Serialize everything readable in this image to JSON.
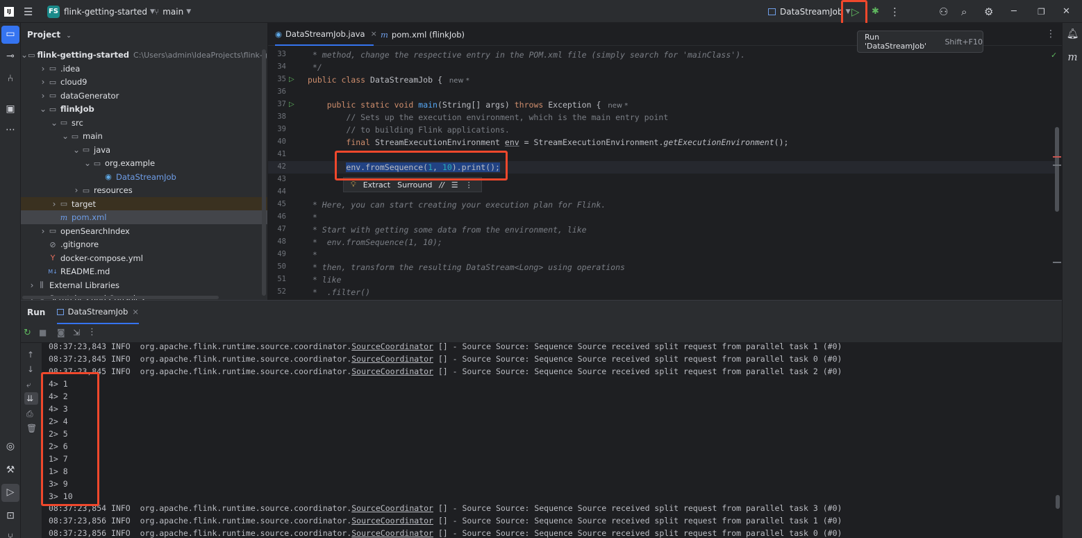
{
  "titlebar": {
    "app_icon": "intellij-icon",
    "menu_icon": "hamburger-icon",
    "project_badge": "FS",
    "project_name": "flink-getting-started",
    "branch_icon": "git-branch-icon",
    "branch": "main",
    "run_config": "DataStreamJob",
    "run_icon": "play-icon",
    "debug_icon": "bug-icon",
    "more_icon": "vertical-dots-icon",
    "add_user_icon": "add-user-icon",
    "search_icon": "search-icon",
    "settings_icon": "gear-icon"
  },
  "tooltip": {
    "label": "Run 'DataStreamJob'",
    "shortcut": "Shift+F10"
  },
  "project": {
    "title": "Project",
    "tree": [
      {
        "label": "flink-getting-started",
        "hint": "C:\\Users\\admin\\IdeaProjects\\flink-getting-started",
        "icon": "folder-icon",
        "depth": 0,
        "expanded": true
      },
      {
        "label": ".idea",
        "icon": "folder-icon",
        "depth": 1,
        "expanded": false
      },
      {
        "label": "cloud9",
        "icon": "folder-icon",
        "depth": 1,
        "expanded": false
      },
      {
        "label": "dataGenerator",
        "icon": "folder-icon",
        "depth": 1,
        "expanded": false
      },
      {
        "label": "flinkJob",
        "icon": "folder-icon",
        "depth": 1,
        "expanded": true
      },
      {
        "label": "src",
        "icon": "folder-icon",
        "depth": 2,
        "expanded": true
      },
      {
        "label": "main",
        "icon": "folder-icon",
        "depth": 3,
        "expanded": true
      },
      {
        "label": "java",
        "icon": "folder-icon",
        "depth": 4,
        "expanded": true
      },
      {
        "label": "org.example",
        "icon": "package-icon",
        "depth": 5,
        "expanded": true
      },
      {
        "label": "DataStreamJob",
        "icon": "class-icon",
        "depth": 6,
        "leaf": true
      },
      {
        "label": "resources",
        "icon": "folder-icon",
        "depth": 4,
        "expanded": false
      },
      {
        "label": "target",
        "icon": "folder-icon",
        "depth": 2,
        "expanded": false
      },
      {
        "label": "pom.xml",
        "icon": "maven-icon",
        "depth": 2,
        "leaf": true
      },
      {
        "label": "openSearchIndex",
        "icon": "folder-icon",
        "depth": 1,
        "expanded": false
      },
      {
        "label": ".gitignore",
        "icon": "ignore-icon",
        "depth": 1,
        "leaf": true
      },
      {
        "label": "docker-compose.yml",
        "icon": "yaml-icon",
        "depth": 1,
        "leaf": true
      },
      {
        "label": "README.md",
        "icon": "markdown-icon",
        "depth": 1,
        "leaf": true
      },
      {
        "label": "External Libraries",
        "icon": "library-icon",
        "depth": 0,
        "expanded": false
      },
      {
        "label": "Scratches and Consoles",
        "icon": "scratch-icon",
        "depth": 0,
        "expanded": false
      }
    ]
  },
  "editor": {
    "tabs": [
      {
        "label": "DataStreamJob.java",
        "active": true
      },
      {
        "label": "pom.xml (flinkJob)",
        "active": false
      }
    ],
    "inline_hint": "new *",
    "popup": {
      "extract": "Extract",
      "surround": "Surround",
      "comment": "//"
    },
    "lines": [
      {
        "num": "33",
        "text": " * method, change the respective entry in the POM.xml file (simply search for 'mainClass')."
      },
      {
        "num": "34",
        "text": " */"
      },
      {
        "num": "35",
        "kw": "public class",
        "name": " DataStreamJob {"
      },
      {
        "num": "36",
        "text": ""
      },
      {
        "num": "37",
        "kw": "public static void",
        "fn": "main",
        "rest": "(String[] args) ",
        "kw2": "throws",
        "rest2": " Exception {"
      },
      {
        "num": "38",
        "text": "// Sets up the execution environment, which is the main entry point"
      },
      {
        "num": "39",
        "text": "// to building Flink applications."
      },
      {
        "num": "40",
        "kw": "final",
        "type": " StreamExecutionEnvironment ",
        "var": "env",
        "eq": " = StreamExecutionEnvironment.",
        "call": "getExecutionEnvironment",
        "end": "();"
      },
      {
        "num": "41",
        "text": ""
      },
      {
        "num": "42",
        "a": "env.fromSequence(",
        "n1": "1",
        "sep": ", ",
        "n2": "10",
        "b": ").print();"
      },
      {
        "num": "43",
        "text": ""
      },
      {
        "num": "44",
        "text": ""
      },
      {
        "num": "45",
        "text": " * Here, you can start creating your execution plan for Flink."
      },
      {
        "num": "46",
        "text": " *"
      },
      {
        "num": "47",
        "text": " * Start with getting some data from the environment, like"
      },
      {
        "num": "48",
        "text": " *  env.fromSequence(1, 10);"
      },
      {
        "num": "49",
        "text": " *"
      },
      {
        "num": "50",
        "text": " * then, transform the resulting DataStream<Long> using operations"
      },
      {
        "num": "51",
        "text": " * like"
      },
      {
        "num": "52",
        "text": " *  .filter()"
      }
    ]
  },
  "run": {
    "title": "Run",
    "tab": "DataStreamJob",
    "console": [
      {
        "ts": "08:37:23,843",
        "level": "INFO",
        "pkg": "org.apache.flink.runtime.source.coordinator.",
        "cls": "SourceCoordinator",
        "msg": " [] - Source Source: Sequence Source received split request from parallel task 1 (#0)"
      },
      {
        "ts": "08:37:23,845",
        "level": "INFO",
        "pkg": "org.apache.flink.runtime.source.coordinator.",
        "cls": "SourceCoordinator",
        "msg": " [] - Source Source: Sequence Source received split request from parallel task 0 (#0)"
      },
      {
        "ts": "08:37:23,845",
        "level": "INFO",
        "pkg": "org.apache.flink.runtime.source.coordinator.",
        "cls": "SourceCoordinator",
        "msg": " [] - Source Source: Sequence Source received split request from parallel task 2 (#0)"
      }
    ],
    "output": [
      "4> 1",
      "4> 2",
      "4> 3",
      "2> 4",
      "2> 5",
      "2> 6",
      "1> 7",
      "1> 8",
      "3> 9",
      "3> 10"
    ],
    "console_after": [
      {
        "ts": "08:37:23,854",
        "level": "INFO",
        "pkg": "org.apache.flink.runtime.source.coordinator.",
        "cls": "SourceCoordinator",
        "msg": " [] - Source Source: Sequence Source received split request from parallel task 3 (#0)"
      },
      {
        "ts": "08:37:23,856",
        "level": "INFO",
        "pkg": "org.apache.flink.runtime.source.coordinator.",
        "cls": "SourceCoordinator",
        "msg": " [] - Source Source: Sequence Source received split request from parallel task 1 (#0)"
      },
      {
        "ts": "08:37:23,856",
        "level": "INFO",
        "pkg": "org.apache.flink.runtime.source.coordinator.",
        "cls": "SourceCoordinator",
        "msg": " [] - Source Source: Sequence Source received split request from parallel task 0 (#0)"
      }
    ]
  },
  "colors": {
    "highlight_box": "#f0482c",
    "accent": "#3574f0",
    "run_green": "#5fb85f"
  }
}
